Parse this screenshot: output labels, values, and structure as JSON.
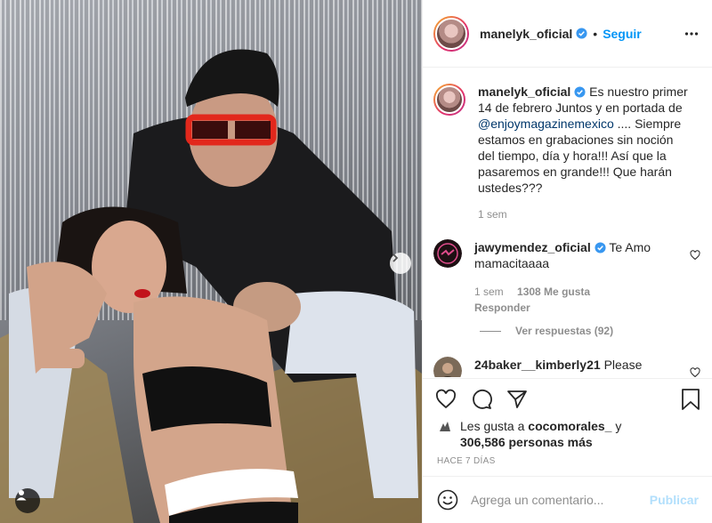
{
  "post": {
    "account": "manelyk_oficial",
    "follow_label": "Seguir",
    "separator": "•",
    "more_icon": "more-horizontal-icon"
  },
  "caption": {
    "username": "manelyk_oficial",
    "text_1": "Es nuestro primer 14 de febrero Juntos y en portada de",
    "mention": "@enjoymagazinemexico",
    "text_2": ".... Siempre estamos en grabaciones sin noción del tiempo, día y hora!!! Así que la pasaremos en grande!!! Que harán ustedes???",
    "time": "1 sem"
  },
  "comments": [
    {
      "username": "jawymendez_oficial",
      "text": "Te Amo mamacitaaaa",
      "time": "1 sem",
      "likes": "1308 Me gusta",
      "reply_label": "Responder",
      "view_replies": "Ver respuestas (92)"
    },
    {
      "username": "24baker__kimberly21",
      "text": "Please"
    }
  ],
  "likes": {
    "prefix": "Les gusta a",
    "user": "cocomorales_",
    "connector": "y",
    "count": "306,586 personas más"
  },
  "date": "HACE 7 DÍAS",
  "add_comment": {
    "placeholder": "Agrega un comentario...",
    "publish_label": "Publicar"
  },
  "colors": {
    "accent": "#0095f6",
    "publish_disabled": "#b2dffc",
    "verified": "#3897f0",
    "muted": "#8e8e8e"
  }
}
